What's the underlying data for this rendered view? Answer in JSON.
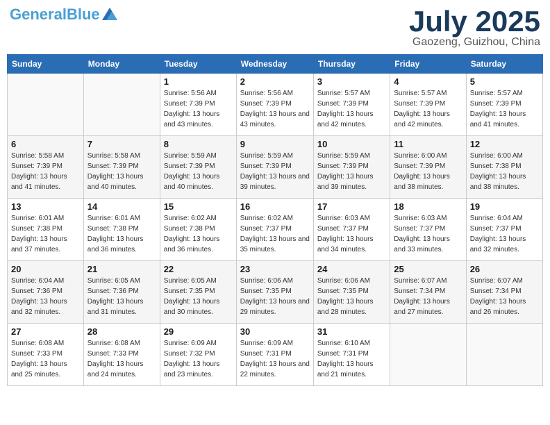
{
  "header": {
    "logo_main": "General",
    "logo_accent": "Blue",
    "month_year": "July 2025",
    "location": "Gaozeng, Guizhou, China"
  },
  "weekdays": [
    "Sunday",
    "Monday",
    "Tuesday",
    "Wednesday",
    "Thursday",
    "Friday",
    "Saturday"
  ],
  "weeks": [
    [
      {
        "day": "",
        "sunrise": "",
        "sunset": "",
        "daylight": ""
      },
      {
        "day": "",
        "sunrise": "",
        "sunset": "",
        "daylight": ""
      },
      {
        "day": "1",
        "sunrise": "Sunrise: 5:56 AM",
        "sunset": "Sunset: 7:39 PM",
        "daylight": "Daylight: 13 hours and 43 minutes."
      },
      {
        "day": "2",
        "sunrise": "Sunrise: 5:56 AM",
        "sunset": "Sunset: 7:39 PM",
        "daylight": "Daylight: 13 hours and 43 minutes."
      },
      {
        "day": "3",
        "sunrise": "Sunrise: 5:57 AM",
        "sunset": "Sunset: 7:39 PM",
        "daylight": "Daylight: 13 hours and 42 minutes."
      },
      {
        "day": "4",
        "sunrise": "Sunrise: 5:57 AM",
        "sunset": "Sunset: 7:39 PM",
        "daylight": "Daylight: 13 hours and 42 minutes."
      },
      {
        "day": "5",
        "sunrise": "Sunrise: 5:57 AM",
        "sunset": "Sunset: 7:39 PM",
        "daylight": "Daylight: 13 hours and 41 minutes."
      }
    ],
    [
      {
        "day": "6",
        "sunrise": "Sunrise: 5:58 AM",
        "sunset": "Sunset: 7:39 PM",
        "daylight": "Daylight: 13 hours and 41 minutes."
      },
      {
        "day": "7",
        "sunrise": "Sunrise: 5:58 AM",
        "sunset": "Sunset: 7:39 PM",
        "daylight": "Daylight: 13 hours and 40 minutes."
      },
      {
        "day": "8",
        "sunrise": "Sunrise: 5:59 AM",
        "sunset": "Sunset: 7:39 PM",
        "daylight": "Daylight: 13 hours and 40 minutes."
      },
      {
        "day": "9",
        "sunrise": "Sunrise: 5:59 AM",
        "sunset": "Sunset: 7:39 PM",
        "daylight": "Daylight: 13 hours and 39 minutes."
      },
      {
        "day": "10",
        "sunrise": "Sunrise: 5:59 AM",
        "sunset": "Sunset: 7:39 PM",
        "daylight": "Daylight: 13 hours and 39 minutes."
      },
      {
        "day": "11",
        "sunrise": "Sunrise: 6:00 AM",
        "sunset": "Sunset: 7:39 PM",
        "daylight": "Daylight: 13 hours and 38 minutes."
      },
      {
        "day": "12",
        "sunrise": "Sunrise: 6:00 AM",
        "sunset": "Sunset: 7:38 PM",
        "daylight": "Daylight: 13 hours and 38 minutes."
      }
    ],
    [
      {
        "day": "13",
        "sunrise": "Sunrise: 6:01 AM",
        "sunset": "Sunset: 7:38 PM",
        "daylight": "Daylight: 13 hours and 37 minutes."
      },
      {
        "day": "14",
        "sunrise": "Sunrise: 6:01 AM",
        "sunset": "Sunset: 7:38 PM",
        "daylight": "Daylight: 13 hours and 36 minutes."
      },
      {
        "day": "15",
        "sunrise": "Sunrise: 6:02 AM",
        "sunset": "Sunset: 7:38 PM",
        "daylight": "Daylight: 13 hours and 36 minutes."
      },
      {
        "day": "16",
        "sunrise": "Sunrise: 6:02 AM",
        "sunset": "Sunset: 7:37 PM",
        "daylight": "Daylight: 13 hours and 35 minutes."
      },
      {
        "day": "17",
        "sunrise": "Sunrise: 6:03 AM",
        "sunset": "Sunset: 7:37 PM",
        "daylight": "Daylight: 13 hours and 34 minutes."
      },
      {
        "day": "18",
        "sunrise": "Sunrise: 6:03 AM",
        "sunset": "Sunset: 7:37 PM",
        "daylight": "Daylight: 13 hours and 33 minutes."
      },
      {
        "day": "19",
        "sunrise": "Sunrise: 6:04 AM",
        "sunset": "Sunset: 7:37 PM",
        "daylight": "Daylight: 13 hours and 32 minutes."
      }
    ],
    [
      {
        "day": "20",
        "sunrise": "Sunrise: 6:04 AM",
        "sunset": "Sunset: 7:36 PM",
        "daylight": "Daylight: 13 hours and 32 minutes."
      },
      {
        "day": "21",
        "sunrise": "Sunrise: 6:05 AM",
        "sunset": "Sunset: 7:36 PM",
        "daylight": "Daylight: 13 hours and 31 minutes."
      },
      {
        "day": "22",
        "sunrise": "Sunrise: 6:05 AM",
        "sunset": "Sunset: 7:35 PM",
        "daylight": "Daylight: 13 hours and 30 minutes."
      },
      {
        "day": "23",
        "sunrise": "Sunrise: 6:06 AM",
        "sunset": "Sunset: 7:35 PM",
        "daylight": "Daylight: 13 hours and 29 minutes."
      },
      {
        "day": "24",
        "sunrise": "Sunrise: 6:06 AM",
        "sunset": "Sunset: 7:35 PM",
        "daylight": "Daylight: 13 hours and 28 minutes."
      },
      {
        "day": "25",
        "sunrise": "Sunrise: 6:07 AM",
        "sunset": "Sunset: 7:34 PM",
        "daylight": "Daylight: 13 hours and 27 minutes."
      },
      {
        "day": "26",
        "sunrise": "Sunrise: 6:07 AM",
        "sunset": "Sunset: 7:34 PM",
        "daylight": "Daylight: 13 hours and 26 minutes."
      }
    ],
    [
      {
        "day": "27",
        "sunrise": "Sunrise: 6:08 AM",
        "sunset": "Sunset: 7:33 PM",
        "daylight": "Daylight: 13 hours and 25 minutes."
      },
      {
        "day": "28",
        "sunrise": "Sunrise: 6:08 AM",
        "sunset": "Sunset: 7:33 PM",
        "daylight": "Daylight: 13 hours and 24 minutes."
      },
      {
        "day": "29",
        "sunrise": "Sunrise: 6:09 AM",
        "sunset": "Sunset: 7:32 PM",
        "daylight": "Daylight: 13 hours and 23 minutes."
      },
      {
        "day": "30",
        "sunrise": "Sunrise: 6:09 AM",
        "sunset": "Sunset: 7:31 PM",
        "daylight": "Daylight: 13 hours and 22 minutes."
      },
      {
        "day": "31",
        "sunrise": "Sunrise: 6:10 AM",
        "sunset": "Sunset: 7:31 PM",
        "daylight": "Daylight: 13 hours and 21 minutes."
      },
      {
        "day": "",
        "sunrise": "",
        "sunset": "",
        "daylight": ""
      },
      {
        "day": "",
        "sunrise": "",
        "sunset": "",
        "daylight": ""
      }
    ]
  ]
}
